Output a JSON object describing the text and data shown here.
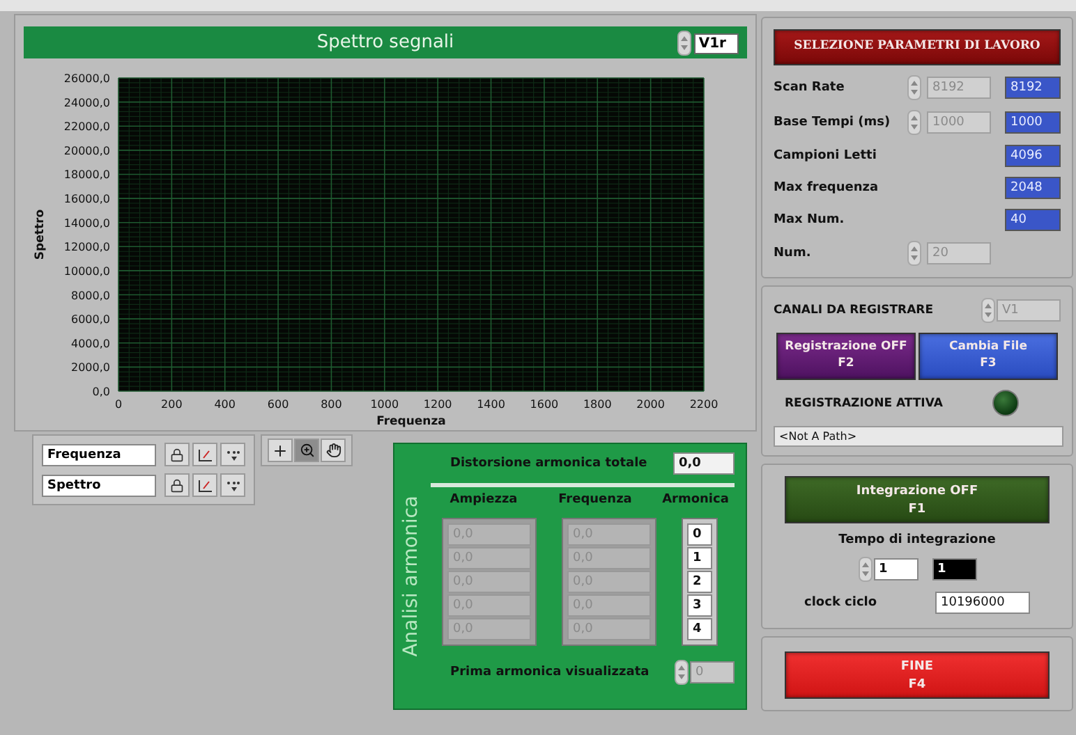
{
  "chart": {
    "channel_selector": "V1r",
    "chart_data": {
      "type": "line",
      "grid": true,
      "title": "Spettro segnali",
      "xlabel": "Frequenza",
      "ylabel": "Spettro",
      "xlim": [
        0,
        2200
      ],
      "ylim": [
        0,
        26000
      ],
      "xticks": [
        0,
        200,
        400,
        600,
        800,
        1000,
        1200,
        1400,
        1600,
        1800,
        2000,
        2200
      ],
      "yticks": [
        {
          "value": 0,
          "label": "0,0"
        },
        {
          "value": 2000,
          "label": "2000,0"
        },
        {
          "value": 4000,
          "label": "4000,0"
        },
        {
          "value": 6000,
          "label": "6000,0"
        },
        {
          "value": 8000,
          "label": "8000,0"
        },
        {
          "value": 10000,
          "label": "10000,0"
        },
        {
          "value": 12000,
          "label": "12000,0"
        },
        {
          "value": 14000,
          "label": "14000,0"
        },
        {
          "value": 16000,
          "label": "16000,0"
        },
        {
          "value": 18000,
          "label": "18000,0"
        },
        {
          "value": 20000,
          "label": "20000,0"
        },
        {
          "value": 22000,
          "label": "22000,0"
        },
        {
          "value": 24000,
          "label": "24000,0"
        },
        {
          "value": 26000,
          "label": "26000,0"
        }
      ]
    }
  },
  "scale_legend": [
    {
      "name": "Frequenza"
    },
    {
      "name": "Spettro"
    }
  ],
  "harmonic_analysis": {
    "title": "Analisi armonica",
    "thd_label": "Distorsione armonica totale",
    "thd_value": "0,0",
    "columns": [
      "Ampiezza",
      "Frequenza",
      "Armonica"
    ],
    "rows": [
      {
        "amplitude": "0,0",
        "frequency": "0,0",
        "harmonic": "0"
      },
      {
        "amplitude": "0,0",
        "frequency": "0,0",
        "harmonic": "1"
      },
      {
        "amplitude": "0,0",
        "frequency": "0,0",
        "harmonic": "2"
      },
      {
        "amplitude": "0,0",
        "frequency": "0,0",
        "harmonic": "3"
      },
      {
        "amplitude": "0,0",
        "frequency": "0,0",
        "harmonic": "4"
      }
    ],
    "first_harmonic_label": "Prima armonica visualizzata",
    "first_harmonic_value": "0"
  },
  "parameters": {
    "button": "SELEZIONE PARAMETRI  DI LAVORO",
    "rows": [
      {
        "label": "Scan Rate",
        "control": "8192",
        "indicator": "8192"
      },
      {
        "label": "Base Tempi (ms)",
        "control": "1000",
        "indicator": "1000"
      },
      {
        "label": "Campioni Letti",
        "indicator": "4096"
      },
      {
        "label": "Max frequenza",
        "indicator": "2048"
      },
      {
        "label": "Max Num.",
        "indicator": "40"
      },
      {
        "label": "Num.",
        "control": "20"
      }
    ]
  },
  "recording": {
    "channels_label": "CANALI DA REGISTRARE",
    "channel": "V1",
    "buttons": [
      {
        "label": "Registrazione OFF",
        "key": "F2",
        "kind": "toggle"
      },
      {
        "label": "Cambia File",
        "key": "F3",
        "kind": "action"
      }
    ],
    "active_label": "REGISTRAZIONE ATTIVA",
    "active_on": false,
    "path": "<Not A Path>"
  },
  "integration": {
    "button": {
      "label": "Integrazione OFF",
      "key": "F1"
    },
    "time_label": "Tempo di integrazione",
    "time_control": "1",
    "time_indicator": "1",
    "clock_label": "clock ciclo",
    "clock_value": "10196000"
  },
  "stop_button": {
    "label": "FINE",
    "key": "F4"
  }
}
